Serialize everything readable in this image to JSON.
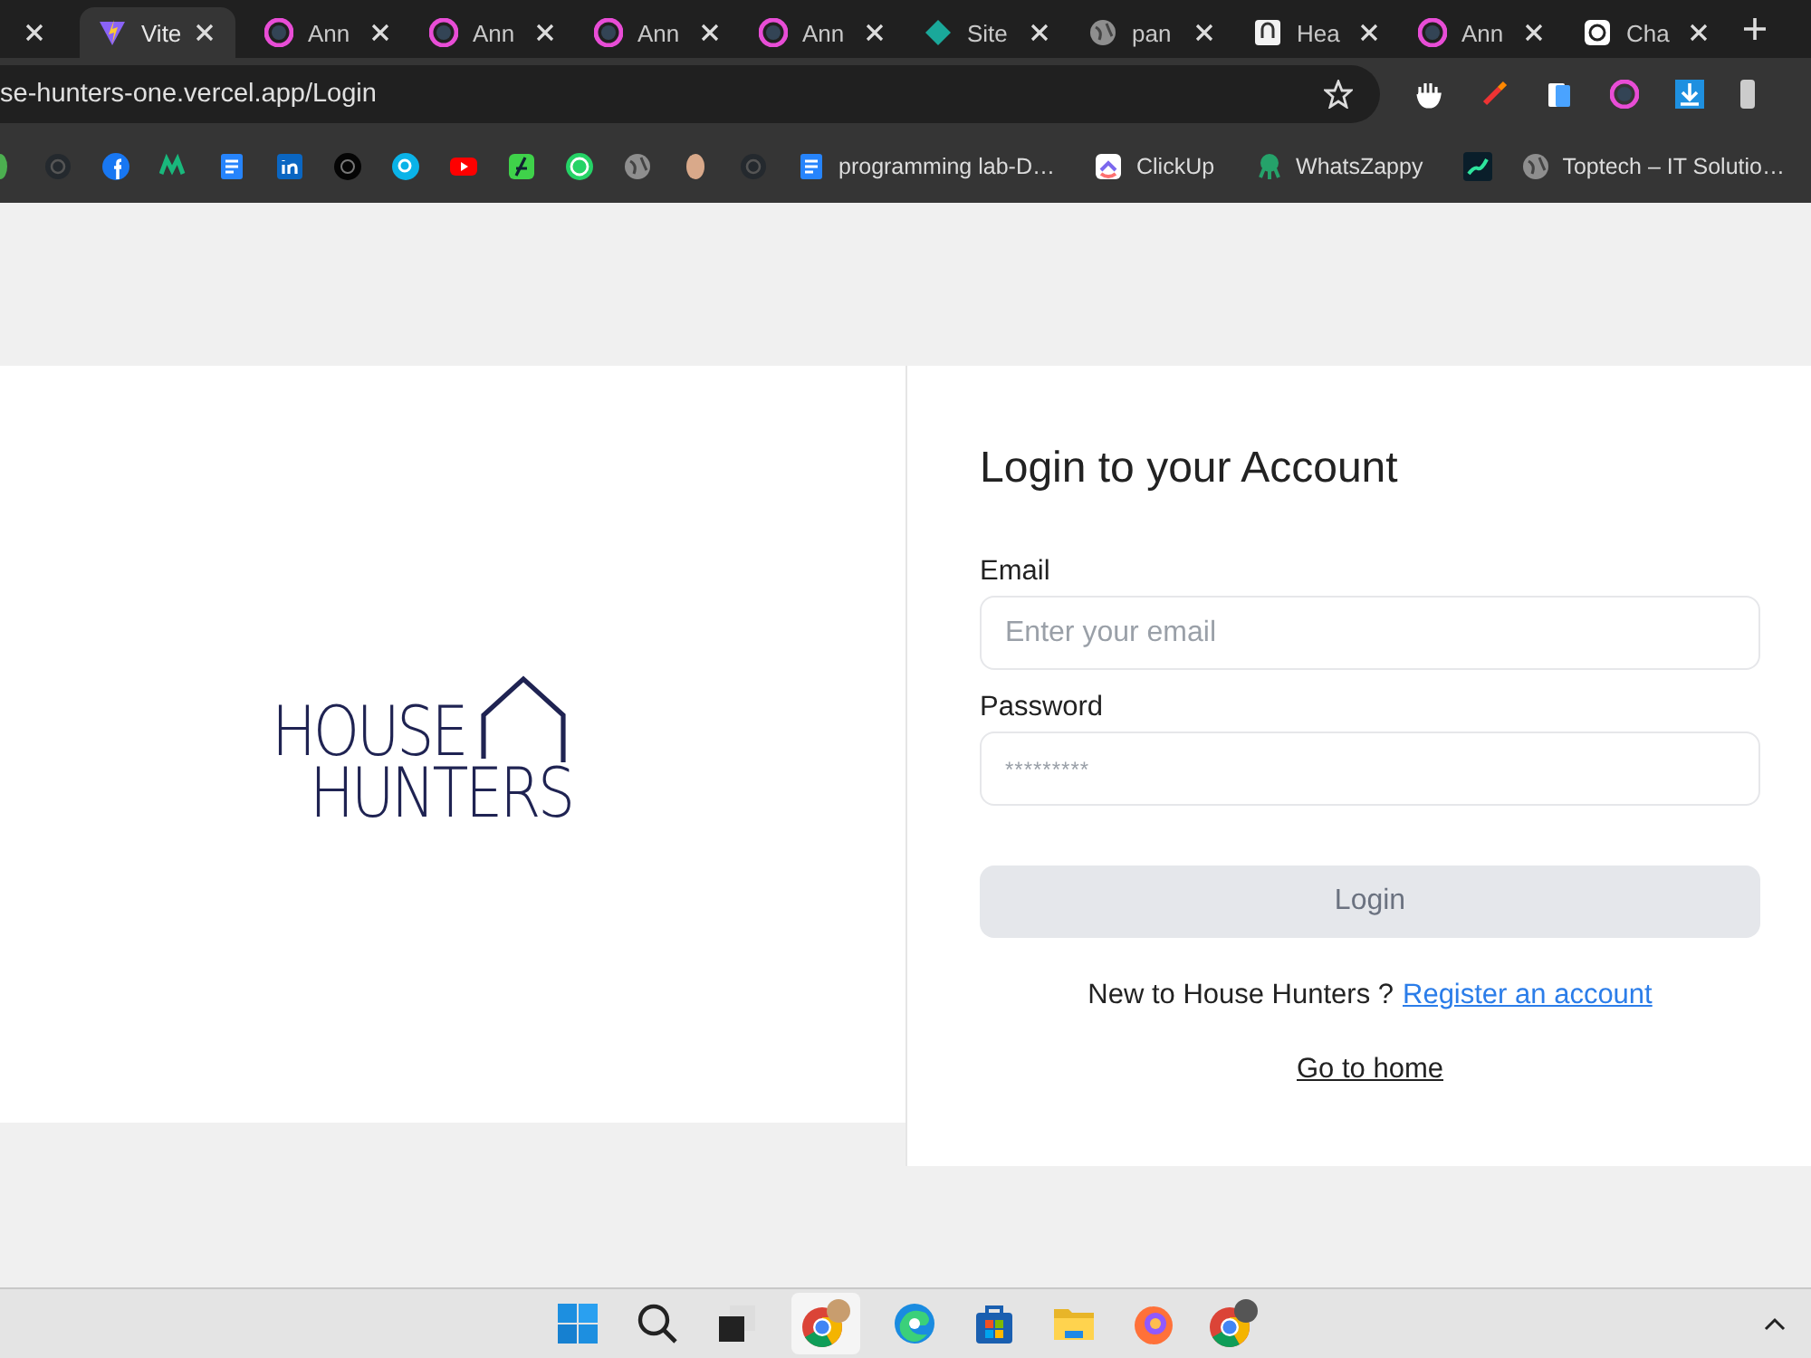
{
  "browser": {
    "tabs": [
      {
        "selected": false
      },
      {
        "label": "Vite",
        "selected": true
      },
      {
        "label": "Ann",
        "selected": false
      },
      {
        "label": "Ann",
        "selected": false
      },
      {
        "label": "Ann",
        "selected": false
      },
      {
        "label": "Ann",
        "selected": false
      },
      {
        "label": "Site",
        "selected": false
      },
      {
        "label": "pan",
        "selected": false
      },
      {
        "label": "Hea",
        "selected": false
      },
      {
        "label": "Ann",
        "selected": false
      },
      {
        "label": "Cha",
        "selected": false
      }
    ],
    "address": "se-hunters-one.vercel.app/Login",
    "bookmarks": [
      {
        "kind": "icon"
      },
      {
        "kind": "icon"
      },
      {
        "kind": "icon"
      },
      {
        "kind": "icon"
      },
      {
        "kind": "icon"
      },
      {
        "kind": "icon"
      },
      {
        "kind": "icon"
      },
      {
        "kind": "icon"
      },
      {
        "kind": "icon"
      },
      {
        "kind": "icon"
      },
      {
        "kind": "icon"
      },
      {
        "kind": "icon"
      },
      {
        "kind": "icon"
      },
      {
        "kind": "icon"
      },
      {
        "kind": "link",
        "label": "programming lab-D…"
      },
      {
        "kind": "link",
        "label": "ClickUp"
      },
      {
        "kind": "link",
        "label": "WhatsZappy"
      },
      {
        "kind": "icon"
      },
      {
        "kind": "link",
        "label": "Toptech – IT Solutio…"
      }
    ]
  },
  "logo": {
    "line_1": "HOUSE",
    "line_2": "HUNTERS"
  },
  "login": {
    "title": "Login to your Account",
    "fields": [
      {
        "label": "Email",
        "placeholder": "Enter your email",
        "kind": "text"
      },
      {
        "label": "Password",
        "placeholder": "*********",
        "kind": "password"
      }
    ],
    "submit": {
      "label": "Login",
      "disabled": true
    },
    "register_prompt": "New to House Hunters ?",
    "register_link": "Register an account",
    "home_link": "Go to home"
  }
}
